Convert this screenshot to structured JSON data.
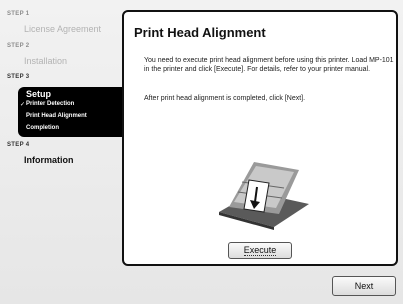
{
  "sidebar": {
    "steps": [
      {
        "label": "STEP 1",
        "title": "License Agreement"
      },
      {
        "label": "STEP 2",
        "title": "Installation"
      },
      {
        "label": "STEP 3",
        "title": "Setup",
        "sub_items": [
          "Printer Detection",
          "Print Head Alignment",
          "Completion"
        ],
        "check_glyph": "✓"
      },
      {
        "label": "STEP 4",
        "title": "Information"
      }
    ]
  },
  "panel": {
    "title": "Print Head Alignment",
    "paragraph1": "You need to execute print head alignment before using this printer. Load MP-101 in the printer and click [Execute]. For details, refer to your printer manual.",
    "paragraph2": "After print head alignment is completed, click [Next].",
    "illustration_icon": "printer-paper-loading-icon",
    "execute_label": "Execute"
  },
  "footer": {
    "next_label": "Next"
  },
  "colors": {
    "accent": "#000000",
    "background": "#ececec",
    "disabled_text": "#b3b3b3"
  }
}
